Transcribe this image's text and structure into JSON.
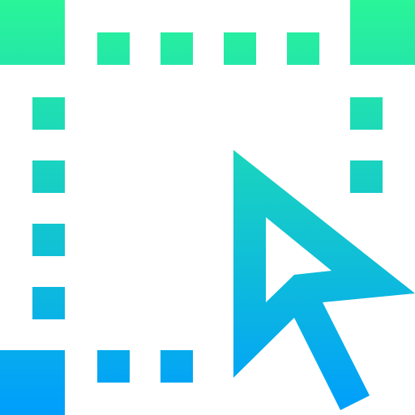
{
  "icon": {
    "name": "area-selection-cursor-icon",
    "gradient": {
      "top_color": "#2AF598",
      "bottom_color": "#009EFD"
    },
    "background_color": "#FFFFFF"
  }
}
